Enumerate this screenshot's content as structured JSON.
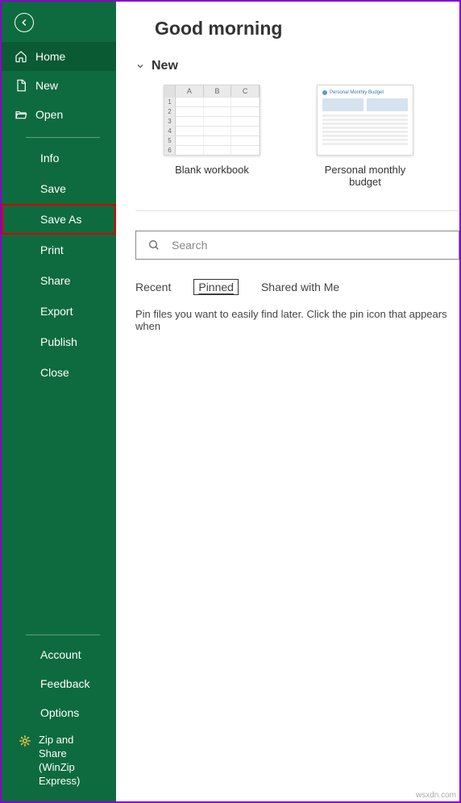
{
  "header": {
    "title": "Good morning"
  },
  "sidebar": {
    "primary": [
      {
        "label": "Home",
        "icon": "home",
        "selected": true
      },
      {
        "label": "New",
        "icon": "file",
        "selected": false
      },
      {
        "label": "Open",
        "icon": "folder",
        "selected": false
      }
    ],
    "secondary": [
      {
        "label": "Info"
      },
      {
        "label": "Save"
      },
      {
        "label": "Save As",
        "highlighted": true
      },
      {
        "label": "Print"
      },
      {
        "label": "Share"
      },
      {
        "label": "Export"
      },
      {
        "label": "Publish"
      },
      {
        "label": "Close"
      }
    ],
    "footer": [
      {
        "label": "Account"
      },
      {
        "label": "Feedback"
      },
      {
        "label": "Options"
      }
    ],
    "zip": {
      "line1": "Zip and Share",
      "line2": "(WinZip",
      "line3": "Express)"
    }
  },
  "new_section": {
    "heading": "New",
    "templates": [
      {
        "label": "Blank workbook",
        "kind": "blank"
      },
      {
        "label": "Personal monthly budget",
        "kind": "budget"
      }
    ]
  },
  "search": {
    "placeholder": "Search",
    "value": ""
  },
  "tabs": {
    "items": [
      {
        "label": "Recent",
        "active": false
      },
      {
        "label": "Pinned",
        "active": true
      },
      {
        "label": "Shared with Me",
        "active": false
      }
    ],
    "empty_message": "Pin files you want to easily find later. Click the pin icon that appears when"
  },
  "watermark": "wsxdn.com",
  "colors": {
    "sidebar_bg": "#0e6b3f",
    "highlight_border": "#d40000",
    "outer_border": "#8800cc"
  }
}
